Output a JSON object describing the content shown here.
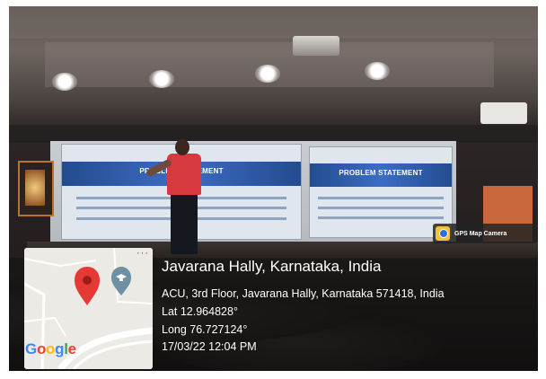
{
  "overlay": {
    "badge": {
      "icon": "gps-map-camera-app-icon",
      "label": "GPS Map Camera"
    },
    "location_title": "Javarana Hally, Karnataka, India",
    "address": "ACU, 3rd Floor, Javarana Hally, Karnataka 571418, India",
    "latitude": "Lat 12.964828°",
    "longitude": "Long 76.727124°",
    "datetime": "17/03/22 12:04 PM"
  },
  "map": {
    "pin_icon": "map-pin-icon",
    "place_icon": "education-place-icon",
    "logo_text": "Google",
    "logo_colors": [
      "#4285F4",
      "#EA4335",
      "#FBBC05",
      "#4285F4",
      "#34A853",
      "#EA4335"
    ],
    "pin_color": "#E53935",
    "place_marker_color": "#6F8FA3"
  },
  "scene": {
    "slides": [
      {
        "title": "PROBLEM STATEMENT"
      },
      {
        "title": "PROBLEM STATEMENT"
      }
    ]
  },
  "colors": {
    "overlay_text": "#FFFFFF",
    "map_background": "#ECEAE4"
  }
}
